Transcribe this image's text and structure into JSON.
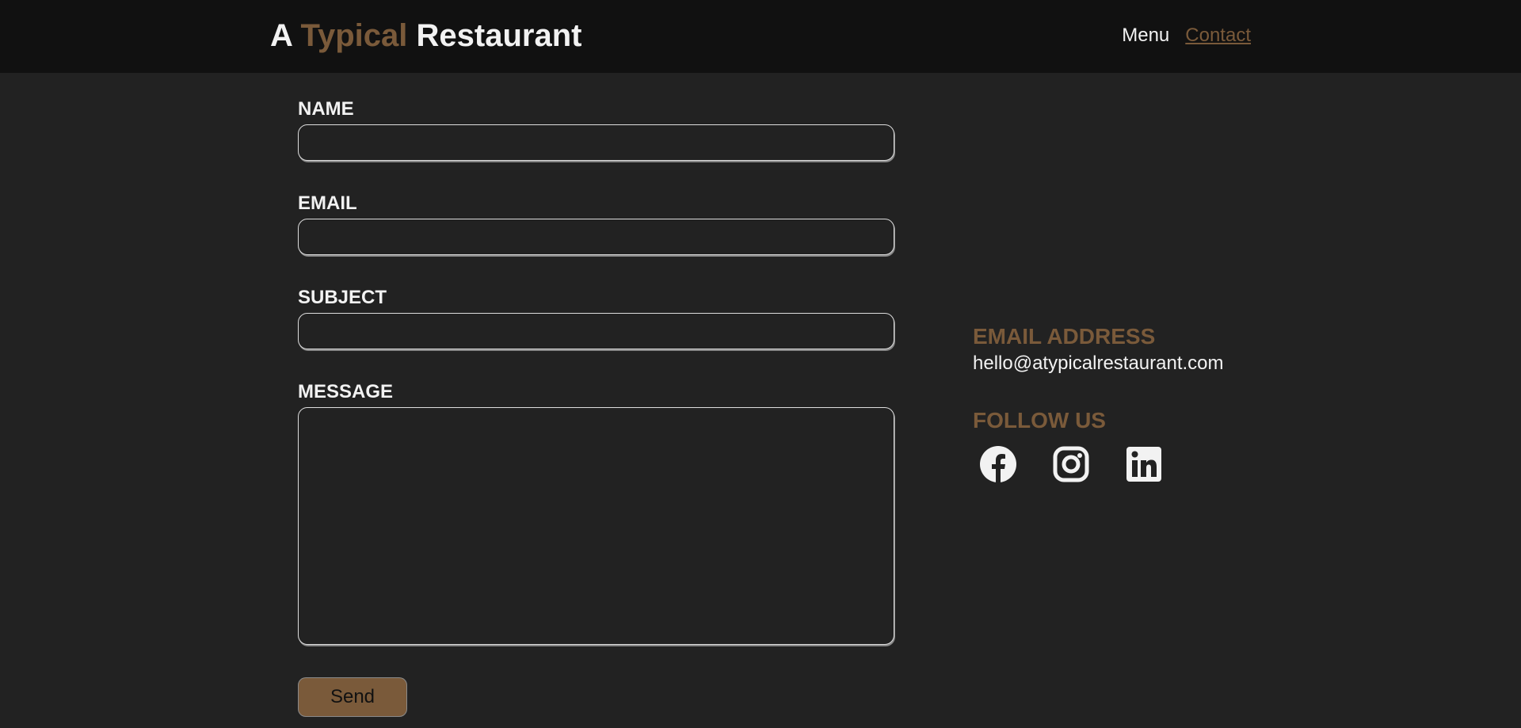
{
  "header": {
    "logo_part1": "A",
    "logo_part2": "Typical",
    "logo_part3": "Restaurant",
    "nav": {
      "menu_label": "Menu",
      "contact_label": "Contact"
    }
  },
  "form": {
    "name_label": "NAME",
    "name_value": "",
    "email_label": "EMAIL",
    "email_value": "",
    "subject_label": "SUBJECT",
    "subject_value": "",
    "message_label": "MESSAGE",
    "message_value": "",
    "send_label": "Send"
  },
  "contact_info": {
    "email_heading": "EMAIL ADDRESS",
    "email_value": "hello@atypicalrestaurant.com",
    "follow_heading": "FOLLOW US",
    "socials": [
      "facebook-icon",
      "instagram-icon",
      "linkedin-icon"
    ]
  },
  "colors": {
    "accent": "#7a5a3a",
    "header_bg": "#111111",
    "page_bg": "#222222",
    "text": "#f2f2f2"
  }
}
